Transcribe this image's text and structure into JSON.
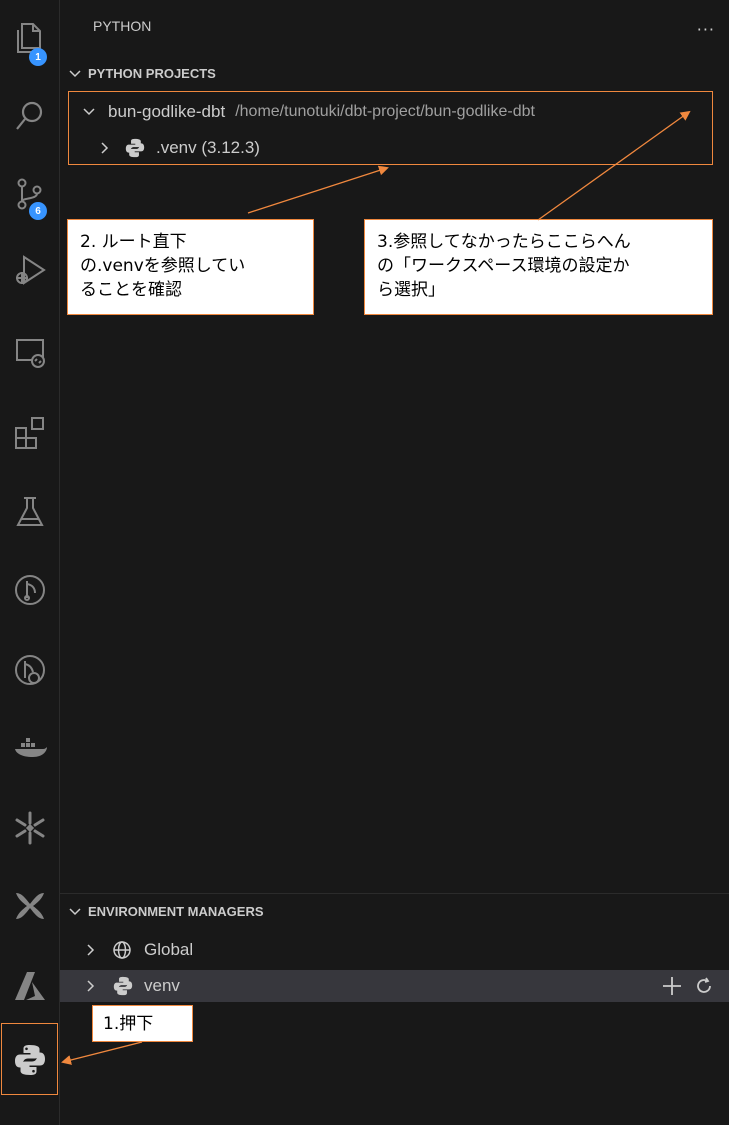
{
  "activity_bar": {
    "items": [
      {
        "name": "explorer-icon",
        "badge": "1"
      },
      {
        "name": "search-icon"
      },
      {
        "name": "source-control-icon",
        "badge": "6"
      },
      {
        "name": "run-debug-icon"
      },
      {
        "name": "remote-explorer-icon"
      },
      {
        "name": "extensions-icon"
      },
      {
        "name": "testing-icon"
      },
      {
        "name": "dbt-icon"
      },
      {
        "name": "dbt-lineage-icon"
      },
      {
        "name": "docker-icon"
      },
      {
        "name": "snowflake-icon"
      },
      {
        "name": "dbt-power-user-icon"
      },
      {
        "name": "azure-icon"
      },
      {
        "name": "python-icon"
      }
    ]
  },
  "sidebar": {
    "title": "PYTHON",
    "more_label": "···",
    "python_projects": {
      "header": "PYTHON PROJECTS",
      "project": {
        "name": "bun-godlike-dbt",
        "path": "/home/tunotuki/dbt-project/bun-godlike-dbt",
        "env_label": ".venv (3.12.3)"
      }
    },
    "environment_managers": {
      "header": "ENVIRONMENT MANAGERS",
      "items": [
        {
          "label": "Global",
          "icon": "globe-icon"
        },
        {
          "label": "venv",
          "icon": "python-icon"
        }
      ]
    }
  },
  "annotations": {
    "note1": "1.押下",
    "note2_l1": "2. ルート直下",
    "note2_l2": "の.venvを参照してい",
    "note2_l3": "ることを確認",
    "note3_l1": "3.参照してなかったらここらへん",
    "note3_l2": "の「ワークスペース環境の設定か",
    "note3_l3": "ら選択」"
  },
  "colors": {
    "background": "#181818",
    "accent_orange": "#f0883e",
    "badge_blue": "#3794ff",
    "selected_row": "#37373d"
  }
}
